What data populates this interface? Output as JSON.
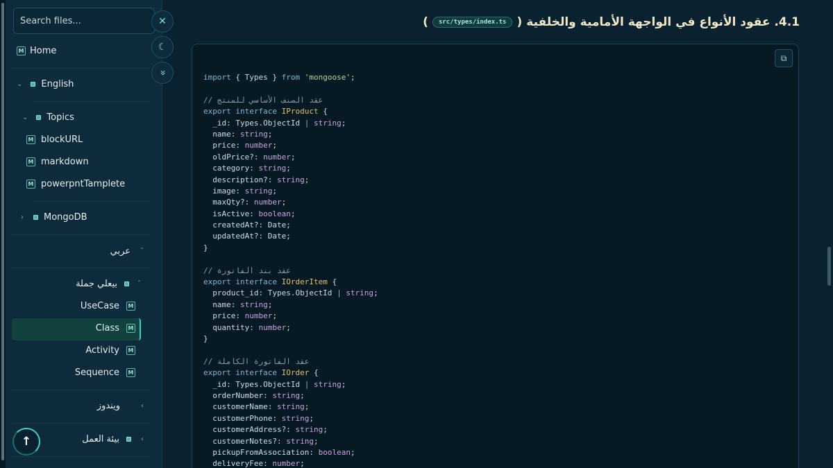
{
  "sidebar": {
    "search_placeholder": "Search files...",
    "home": "Home",
    "english": "English",
    "topics": "Topics",
    "topic_items": [
      "blockURL",
      "markdown",
      "powerpntTamplete"
    ],
    "mongodb": "MongoDB",
    "arabic": "عربي",
    "sentence": "بيعلي جملة",
    "sub_items": [
      "UseCase",
      "Class",
      "Activity",
      "Sequence"
    ],
    "active_item": "Class",
    "windows": "ويندوز",
    "workspace": "بيئة العمل",
    "badge": "M"
  },
  "floating": {
    "close_icon": "✕",
    "theme_icon": "☾",
    "collapse_icon": "»"
  },
  "content": {
    "heading_text": "4.1. عقود الأنواع في الواجهة الأمامية والخلفية",
    "file_path": "src/types/index.ts",
    "paren_open": "(",
    "paren_close": ")"
  },
  "code_lines": [
    [
      [
        "kw",
        "import"
      ],
      [
        "p",
        " { Types } "
      ],
      [
        "kw",
        "from"
      ],
      [
        "p",
        " "
      ],
      [
        "str",
        "'mongoose'"
      ],
      [
        "p",
        ";"
      ]
    ],
    [
      [
        "p",
        ""
      ]
    ],
    [
      [
        "com",
        "// عقد الصنف الأساسي للمنتج"
      ]
    ],
    [
      [
        "kw",
        "export interface "
      ],
      [
        "type",
        "IProduct"
      ],
      [
        "p",
        " {"
      ]
    ],
    [
      [
        "p",
        "  _id: Types.ObjectId "
      ],
      [
        "kw",
        "|"
      ],
      [
        "p",
        " "
      ],
      [
        "prim",
        "string"
      ],
      [
        "p",
        ";"
      ]
    ],
    [
      [
        "p",
        "  name: "
      ],
      [
        "prim",
        "string"
      ],
      [
        "p",
        ";"
      ]
    ],
    [
      [
        "p",
        "  price: "
      ],
      [
        "prim",
        "number"
      ],
      [
        "p",
        ";"
      ]
    ],
    [
      [
        "p",
        "  oldPrice?: "
      ],
      [
        "prim",
        "number"
      ],
      [
        "p",
        ";"
      ]
    ],
    [
      [
        "p",
        "  category: "
      ],
      [
        "prim",
        "string"
      ],
      [
        "p",
        ";"
      ]
    ],
    [
      [
        "p",
        "  description?: "
      ],
      [
        "prim",
        "string"
      ],
      [
        "p",
        ";"
      ]
    ],
    [
      [
        "p",
        "  image: "
      ],
      [
        "prim",
        "string"
      ],
      [
        "p",
        ";"
      ]
    ],
    [
      [
        "p",
        "  maxQty?: "
      ],
      [
        "prim",
        "number"
      ],
      [
        "p",
        ";"
      ]
    ],
    [
      [
        "p",
        "  isActive: "
      ],
      [
        "prim",
        "boolean"
      ],
      [
        "p",
        ";"
      ]
    ],
    [
      [
        "p",
        "  createdAt?: Date;"
      ]
    ],
    [
      [
        "p",
        "  updatedAt?: Date;"
      ]
    ],
    [
      [
        "p",
        "}"
      ]
    ],
    [
      [
        "p",
        ""
      ]
    ],
    [
      [
        "com",
        "// عقد بند الفاتورة"
      ]
    ],
    [
      [
        "kw",
        "export interface "
      ],
      [
        "type",
        "IOrderItem"
      ],
      [
        "p",
        " {"
      ]
    ],
    [
      [
        "p",
        "  product_id: Types.ObjectId "
      ],
      [
        "kw",
        "|"
      ],
      [
        "p",
        " "
      ],
      [
        "prim",
        "string"
      ],
      [
        "p",
        ";"
      ]
    ],
    [
      [
        "p",
        "  name: "
      ],
      [
        "prim",
        "string"
      ],
      [
        "p",
        ";"
      ]
    ],
    [
      [
        "p",
        "  price: "
      ],
      [
        "prim",
        "number"
      ],
      [
        "p",
        ";"
      ]
    ],
    [
      [
        "p",
        "  quantity: "
      ],
      [
        "prim",
        "number"
      ],
      [
        "p",
        ";"
      ]
    ],
    [
      [
        "p",
        "}"
      ]
    ],
    [
      [
        "p",
        ""
      ]
    ],
    [
      [
        "com",
        "// عقد الفاتورة الكاملة"
      ]
    ],
    [
      [
        "kw",
        "export interface "
      ],
      [
        "type",
        "IOrder"
      ],
      [
        "p",
        " {"
      ]
    ],
    [
      [
        "p",
        "  _id: Types.ObjectId "
      ],
      [
        "kw",
        "|"
      ],
      [
        "p",
        " "
      ],
      [
        "prim",
        "string"
      ],
      [
        "p",
        ";"
      ]
    ],
    [
      [
        "p",
        "  orderNumber: "
      ],
      [
        "prim",
        "string"
      ],
      [
        "p",
        ";"
      ]
    ],
    [
      [
        "p",
        "  customerName: "
      ],
      [
        "prim",
        "string"
      ],
      [
        "p",
        ";"
      ]
    ],
    [
      [
        "p",
        "  customerPhone: "
      ],
      [
        "prim",
        "string"
      ],
      [
        "p",
        ";"
      ]
    ],
    [
      [
        "p",
        "  customerAddress?: "
      ],
      [
        "prim",
        "string"
      ],
      [
        "p",
        ";"
      ]
    ],
    [
      [
        "p",
        "  customerNotes?: "
      ],
      [
        "prim",
        "string"
      ],
      [
        "p",
        ";"
      ]
    ],
    [
      [
        "p",
        "  pickupFromAssociation: "
      ],
      [
        "prim",
        "boolean"
      ],
      [
        "p",
        ";"
      ]
    ],
    [
      [
        "p",
        "  deliveryFee: "
      ],
      [
        "prim",
        "number"
      ],
      [
        "p",
        ";"
      ]
    ]
  ]
}
